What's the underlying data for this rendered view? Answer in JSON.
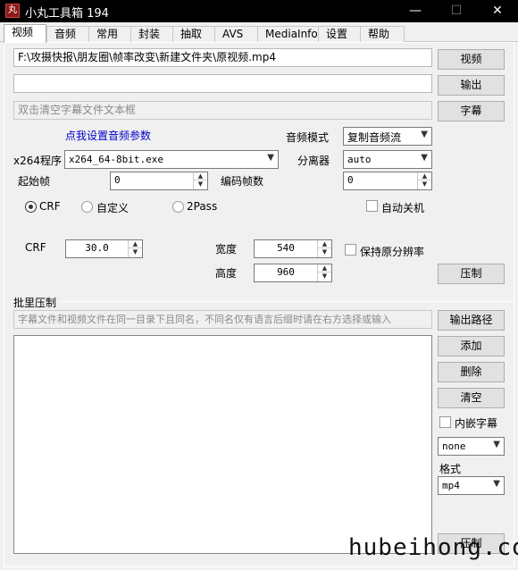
{
  "window": {
    "title": "小丸工具箱 194",
    "icon_text": "丸",
    "minimize": "—",
    "maximize": "☐",
    "close": "✕"
  },
  "tabs": [
    "视频",
    "音频",
    "常用",
    "封装",
    "抽取",
    "AVS",
    "MediaInfo",
    "设置",
    "帮助"
  ],
  "video": {
    "input_path": "F:\\攻摄快报\\朋友圈\\帧率改变\\新建文件夹\\原视频.mp4",
    "output_path": "",
    "subtitle_placeholder": "双击清空字幕文件文本框",
    "btn_video": "视频",
    "btn_output": "输出",
    "btn_subtitle": "字幕",
    "audio_params_link": "点我设置音频参数",
    "audio_mode_label": "音频模式",
    "audio_mode_value": "复制音频流",
    "x264_label": "x264程序",
    "x264_value": "x264_64-8bit.exe",
    "splitter_label": "分离器",
    "splitter_value": "auto",
    "start_frame_label": "起始帧",
    "start_frame_value": "0",
    "encode_frames_label": "编码帧数",
    "encode_frames_value": "0",
    "mode_crf": "CRF",
    "mode_custom": "自定义",
    "mode_2pass": "2Pass",
    "auto_shutdown": "自动关机",
    "crf_label": "CRF",
    "crf_value": "30.0",
    "width_label": "宽度",
    "width_value": "540",
    "height_label": "高度",
    "height_value": "960",
    "keep_resolution": "保持原分辨率",
    "btn_compress": "压制"
  },
  "batch": {
    "title": "批里压制",
    "hint": "字幕文件和视频文件在同一目录下且同名，不同名仅有语言后缀时请在右方选择或输入",
    "btn_output_path": "输出路径",
    "btn_add": "添加",
    "btn_delete": "删除",
    "btn_clear": "清空",
    "embed_subtitle": "内嵌字幕",
    "subtitle_lang_value": "none",
    "format_label": "格式",
    "format_value": "mp4",
    "btn_compress": "压制"
  },
  "watermark": "hubeihong.com"
}
